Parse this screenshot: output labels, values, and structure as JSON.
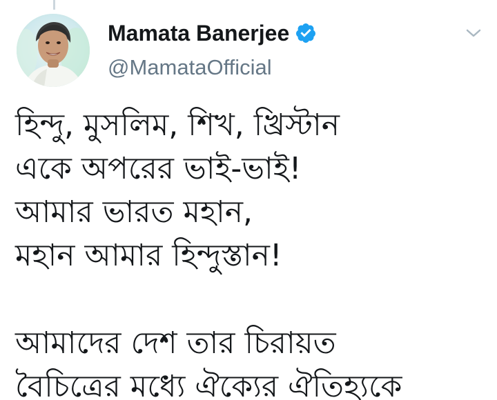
{
  "tweet": {
    "display_name": "Mamata Banerjee",
    "handle": "@MamataOfficial",
    "verified": true,
    "accent_color": "#1da1f2",
    "icons": {
      "verified": "verified-badge-icon",
      "menu": "chevron-down-icon"
    },
    "lines": [
      "হিন্দু, মুসলিম, শিখ, খ্রিস্টান",
      "একে অপরের ভাই-ভাই!",
      "আমার ভারত মহান,",
      "মহান আমার হিন্দুস্তান!",
      "",
      "আমাদের দেশ তার চিরায়ত",
      "বৈচিত্রের মধ্যে ঐক্যের ঐতিহ্যকে"
    ]
  }
}
